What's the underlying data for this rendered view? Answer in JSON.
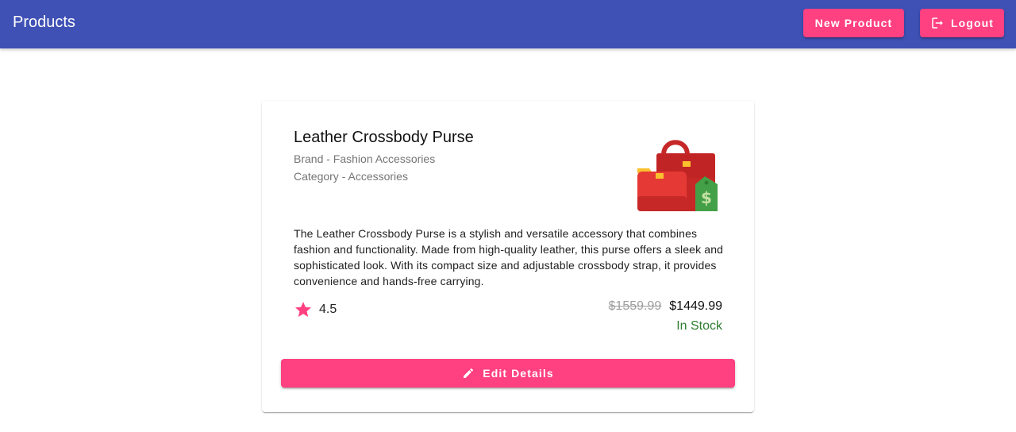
{
  "appbar": {
    "title": "Products",
    "new_product_label": "New Product",
    "logout_label": "Logout",
    "logout_icon": "logout-icon",
    "background": "#3f51b5",
    "accent": "#ff4081"
  },
  "product": {
    "name": "Leather Crossbody Purse",
    "brand": "Brand - Fashion Accessories",
    "category": "Category - Accessories",
    "image_icon": "handbag-with-price-tag-icon",
    "description": "The Leather Crossbody Purse is a stylish and versatile accessory that combines fashion and functionality. Made from high-quality leather, this purse offers a sleek and sophisticated look. With its compact size and adjustable crossbody strap, it provides convenience and hands-free carrying.",
    "rating": "4.5",
    "rating_icon": "star-icon",
    "original_price": "$1559.99",
    "price": "$1449.99",
    "stock_status": "In Stock",
    "stock_color": "#2e7d32",
    "edit_label": "Edit Details",
    "edit_icon": "pencil-icon"
  }
}
